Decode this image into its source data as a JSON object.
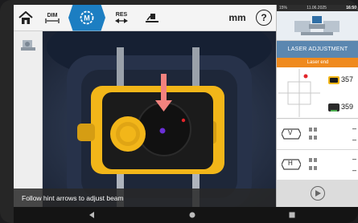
{
  "toolbar": {
    "dim_label": "DIM",
    "res_label": "RES",
    "unit_label": "mm",
    "help_label": "?"
  },
  "camera": {
    "hint": "Follow hint arrows to adjust beam"
  },
  "status_bar": {
    "battery": "15%",
    "date": "11.06.2025",
    "time": "16:50"
  },
  "panel": {
    "title": "LASER ADJUSTMENT",
    "subtitle": "Laser end",
    "value_1": "357",
    "value_2": "359",
    "row_v_label": "V",
    "row_h_label": "H",
    "dash": "–"
  },
  "colors": {
    "accent_blue": "#1c7ec2",
    "header_blue": "#5b87b0",
    "orange": "#ef8a1e",
    "sensor_yellow": "#f2b619"
  },
  "icons": {
    "home": "home-icon",
    "measure": "measure-icon",
    "flip": "flip-icon",
    "play": "play-icon"
  }
}
